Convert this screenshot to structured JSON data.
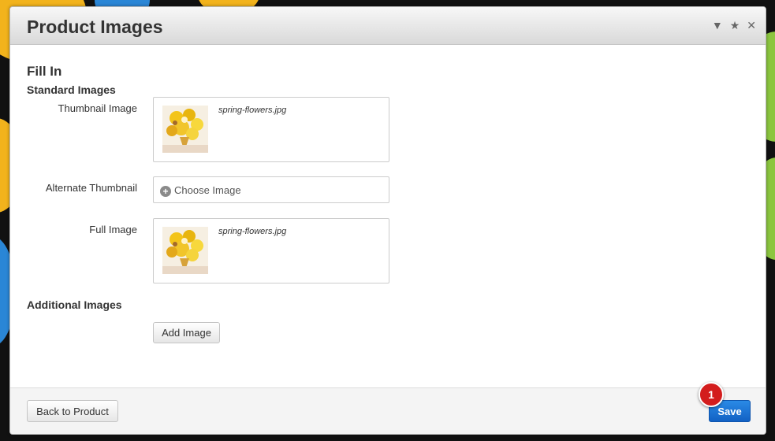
{
  "dialog": {
    "title": "Product Images",
    "header_icons": [
      "chevron-down-icon",
      "star-icon",
      "close-icon"
    ]
  },
  "form": {
    "section_title": "Fill In",
    "standard_images_title": "Standard Images",
    "thumbnail": {
      "label": "Thumbnail Image",
      "file_name": "spring-flowers.jpg"
    },
    "alternate_thumbnail": {
      "label": "Alternate Thumbnail",
      "button_label": "Choose Image"
    },
    "full_image": {
      "label": "Full Image",
      "file_name": "spring-flowers.jpg"
    },
    "additional_images_title": "Additional Images",
    "add_image_label": "Add Image"
  },
  "footer": {
    "back_label": "Back to Product",
    "save_label": "Save",
    "step_badge": "1"
  },
  "colors": {
    "save_button": "#1a73d6",
    "step_badge": "#d31d1d"
  }
}
